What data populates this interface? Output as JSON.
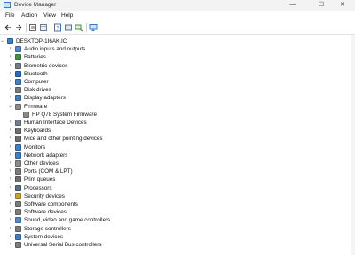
{
  "window": {
    "title": "Device Manager",
    "minimize_glyph": "—",
    "maximize_glyph": "☐",
    "close_glyph": "✕"
  },
  "menu": [
    "File",
    "Action",
    "View",
    "Help"
  ],
  "toolbar": {
    "buttons": [
      "back-arrow-icon",
      "forward-arrow-icon",
      "properties-icon",
      "show-hide-icon",
      "help-icon",
      "update-driver-icon",
      "scan-hardware-icon",
      "computer-monitor-icon"
    ]
  },
  "tree": {
    "root": {
      "label": "DESKTOP-1I6AK.IC",
      "expander": "⌄",
      "icon": "computer-icon"
    },
    "expander_collapsed": "›",
    "expander_expanded": "⌄",
    "items": [
      {
        "label": "Audio inputs and outputs",
        "icon": "audio-icon",
        "color": "#4b8bd4"
      },
      {
        "label": "Batteries",
        "icon": "battery-icon",
        "color": "#3c9a3c"
      },
      {
        "label": "Biometric devices",
        "icon": "biometric-icon",
        "color": "#6f7f90"
      },
      {
        "label": "Bluetooth",
        "icon": "bluetooth-icon",
        "color": "#1f6fd1"
      },
      {
        "label": "Computer",
        "icon": "computer-icon",
        "color": "#3d7fc9"
      },
      {
        "label": "Disk drives",
        "icon": "disk-icon",
        "color": "#7c7c7c"
      },
      {
        "label": "Display adapters",
        "icon": "display-icon",
        "color": "#3d7fc9"
      },
      {
        "label": "Firmware",
        "icon": "firmware-icon",
        "color": "#8a8a8a",
        "expanded": true,
        "children": [
          {
            "label": "HP Q78 System Firmware",
            "icon": "firmware-chip-icon",
            "color": "#8a8a8a"
          }
        ]
      },
      {
        "label": "Human Interface Devices",
        "icon": "hid-icon",
        "color": "#6f7f90"
      },
      {
        "label": "Keyboards",
        "icon": "keyboard-icon",
        "color": "#6f6f6f"
      },
      {
        "label": "Mice and other pointing devices",
        "icon": "mouse-icon",
        "color": "#6f6f6f"
      },
      {
        "label": "Monitors",
        "icon": "monitor-icon",
        "color": "#3d7fc9"
      },
      {
        "label": "Network adapters",
        "icon": "network-icon",
        "color": "#3d7fc9"
      },
      {
        "label": "Other devices",
        "icon": "other-devices-icon",
        "color": "#8a8a8a"
      },
      {
        "label": "Ports (COM & LPT)",
        "icon": "port-icon",
        "color": "#7c7c7c"
      },
      {
        "label": "Print queues",
        "icon": "printer-icon",
        "color": "#6f6f6f"
      },
      {
        "label": "Processors",
        "icon": "processor-icon",
        "color": "#5a6f88"
      },
      {
        "label": "Security devices",
        "icon": "security-icon",
        "color": "#c9a227"
      },
      {
        "label": "Software components",
        "icon": "software-component-icon",
        "color": "#7c7c7c"
      },
      {
        "label": "Software devices",
        "icon": "software-device-icon",
        "color": "#7c7c7c"
      },
      {
        "label": "Sound, video and game controllers",
        "icon": "sound-icon",
        "color": "#4b8bd4"
      },
      {
        "label": "Storage controllers",
        "icon": "storage-icon",
        "color": "#7c7c7c"
      },
      {
        "label": "System devices",
        "icon": "system-icon",
        "color": "#3d7fc9"
      },
      {
        "label": "Universal Serial Bus controllers",
        "icon": "usb-icon",
        "color": "#7c7c7c"
      }
    ]
  }
}
